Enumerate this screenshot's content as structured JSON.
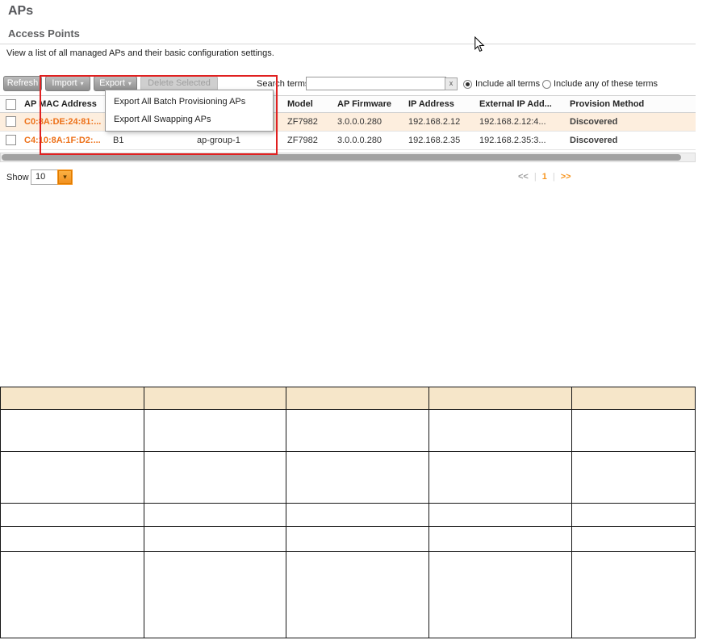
{
  "page": {
    "title": "APs"
  },
  "section": {
    "title": "Access Points",
    "description": "View a list of all managed APs and their basic configuration settings."
  },
  "toolbar": {
    "refresh_label": "Refresh",
    "import_label": "Import",
    "export_label": "Export",
    "delete_label": "Delete Selected",
    "search_label": "Search terms:",
    "search_value": "",
    "clear_label": "x",
    "include_all_label": "Include all terms",
    "include_any_label": "Include any of these terms"
  },
  "export_menu": {
    "items": [
      "Export All Batch Provisioning APs",
      "Export All Swapping APs"
    ]
  },
  "ap_table": {
    "columns": [
      "AP MAC Address",
      "",
      "",
      "Model",
      "AP Firmware",
      "IP Address",
      "External IP Add...",
      "Provision Method"
    ],
    "rows": [
      {
        "mac": "C0:8A:DE:24:81:...",
        "device_name": "",
        "ap_group": "",
        "model": "ZF7982",
        "firmware": "3.0.0.0.280",
        "ip_address": "192.168.2.12",
        "external_ip": "192.168.2.12:4...",
        "provision_method": "Discovered"
      },
      {
        "mac": "C4:10:8A:1F:D2:...",
        "device_name": "B1",
        "ap_group": "ap-group-1",
        "model": "ZF7982",
        "firmware": "3.0.0.0.280",
        "ip_address": "192.168.2.35",
        "external_ip": "192.168.2.35:3...",
        "provision_method": "Discovered"
      }
    ]
  },
  "pagination": {
    "show_label": "Show",
    "page_size": "10",
    "first": "<<",
    "separator": "|",
    "current_page": "1",
    "last": ">>"
  },
  "colors": {
    "accent_orange": "#F7941D",
    "selected_row_bg": "#FDEEDE",
    "highlight_border": "#E02020",
    "empty_table_header_bg": "#F6E6C9"
  }
}
